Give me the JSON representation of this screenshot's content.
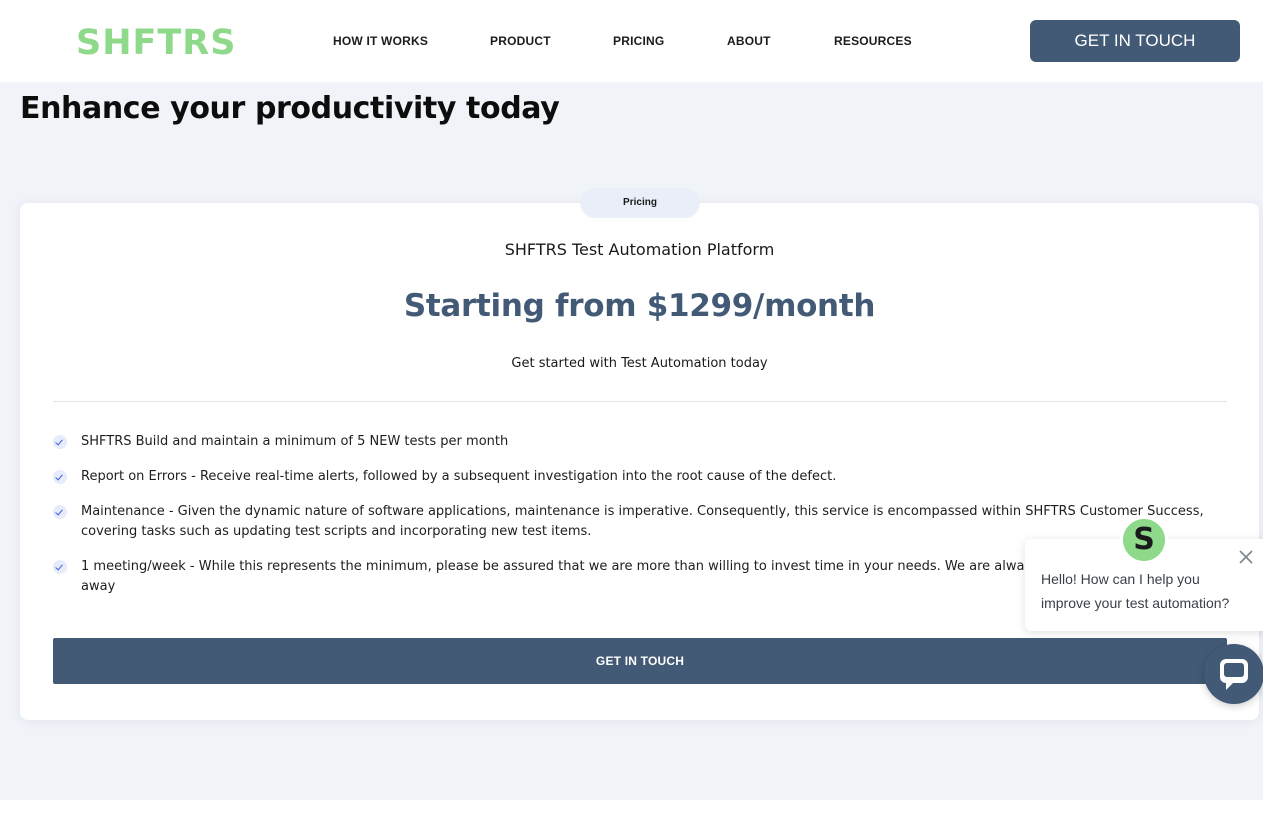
{
  "header": {
    "logo_text": "SHFTRS",
    "nav": [
      "HOW IT WORKS",
      "PRODUCT",
      "PRICING",
      "ABOUT",
      "RESOURCES"
    ],
    "cta_label": "GET IN TOUCH"
  },
  "main": {
    "title": "Enhance your productivity today",
    "card": {
      "badge": "Pricing",
      "product_name": "SHFTRS Test Automation Platform",
      "price": "Starting from $1299/month",
      "subtitle": "Get started with Test Automation today",
      "features": [
        "SHFTRS Build and maintain a minimum of 5 NEW tests per month",
        "Report on Errors - Receive real-time alerts, followed by a subsequent investigation into the root cause of the defect.",
        "Maintenance - Given the dynamic nature of software applications, maintenance is imperative. Consequently, this service is encompassed within SHFTRS Customer Success, covering tasks such as updating test scripts and incorporating new test items.",
        "1 meeting/week - While this represents the minimum, please be assured that we are more than willing to invest time in your needs. We are alwa",
        "away"
      ],
      "cta_label": "GET IN TOUCH"
    }
  },
  "chat": {
    "avatar_letter": "S",
    "message": "Hello! How can I help you improve your test automation?",
    "icons": {
      "close": "close-icon",
      "launcher": "chat-bubble-icon",
      "check": "check-icon"
    }
  },
  "colors": {
    "brand_green": "#8ed98a",
    "accent_slate": "#425a76",
    "page_bg": "#f0f3f8",
    "check_blue": "#3d5ad8"
  }
}
